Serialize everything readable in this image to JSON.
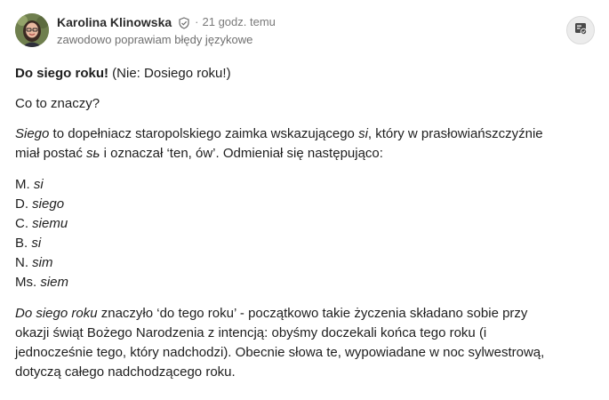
{
  "author": {
    "name": "Karolina Klinowska",
    "separator": "·",
    "time": "21 godz. temu",
    "tagline": "zawodowo poprawiam błędy językowe"
  },
  "icons": {
    "verified": "shield-check-icon",
    "action": "save-bookmark-icon",
    "avatar": "profile-photo"
  },
  "colors": {
    "name": "#2a2a2a",
    "meta": "#7a7a7a",
    "body": "#1e1e1e",
    "button_bg": "#ececec"
  },
  "post": {
    "title_bold": "Do siego roku!",
    "title_rest": " (Nie: Dosiego roku!)",
    "question": "Co to znaczy?",
    "para1_term": "Siego",
    "para1_a": " to dopełniacz staropolskiego zaimka wskazującego ",
    "para1_si": "si",
    "para1_b": ", który w prasłowiańszczyźnie",
    "para1_c": "miał postać ",
    "para1_form": "sь",
    "para1_d": " i oznaczał ‘ten, ów’. Odmieniał się następująco:",
    "cases": [
      {
        "label": "M. ",
        "form": "si"
      },
      {
        "label": "D. ",
        "form": "siego"
      },
      {
        "label": "C. ",
        "form": "siemu"
      },
      {
        "label": "B. ",
        "form": "si"
      },
      {
        "label": "N. ",
        "form": "sim"
      },
      {
        "label": "Ms. ",
        "form": "siem"
      }
    ],
    "para2_term": "Do siego roku",
    "para2_l1": " znaczyło ‘do tego roku’ - początkowo takie życzenia składano sobie przy",
    "para2_l2": "okazji świąt Bożego Narodzenia z intencją: obyśmy doczekali końca tego roku (i",
    "para2_l3": "jednocześnie tego, który nadchodzi). Obecnie słowa te, wypowiadane w noc sylwestrową,",
    "para2_l4": "dotyczą całego nadchodzącego roku."
  }
}
